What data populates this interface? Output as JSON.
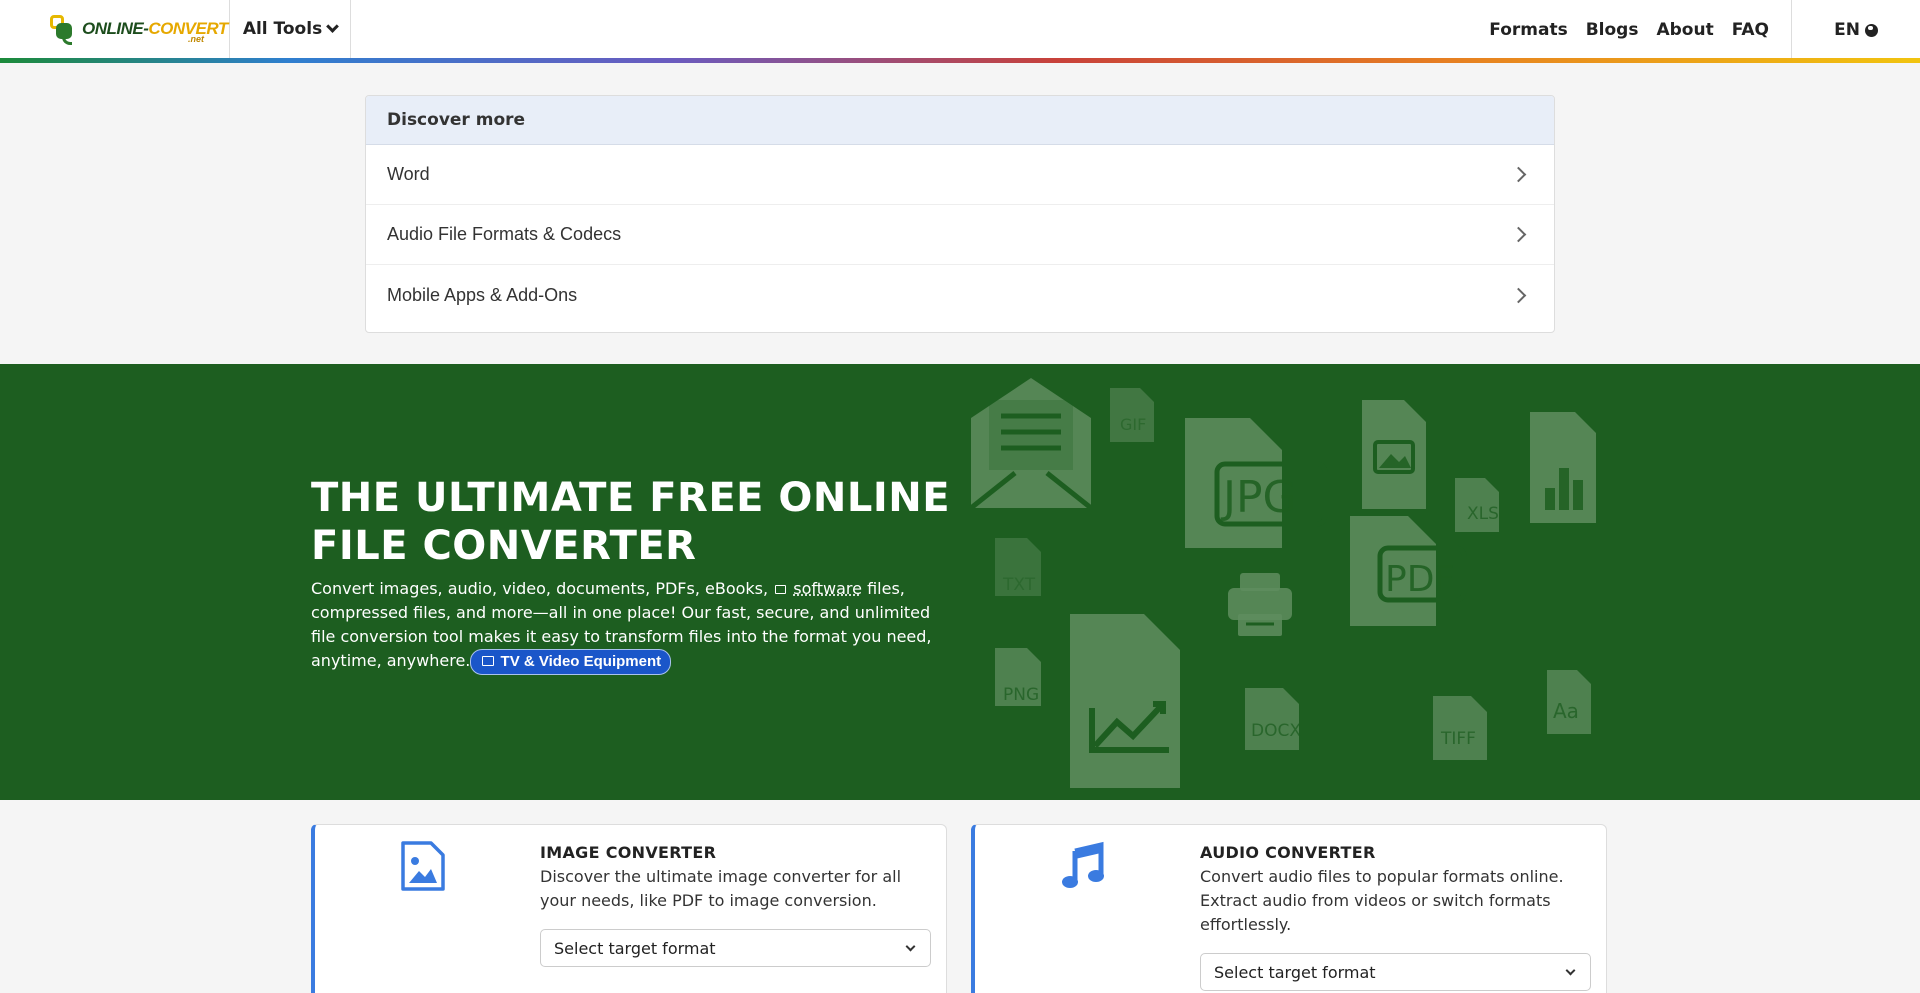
{
  "header": {
    "logo": {
      "part1": "ONLINE-",
      "part2": "CONVERT",
      "sub": ".net"
    },
    "all_tools_label": "All Tools",
    "nav": [
      "Formats",
      "Blogs",
      "About",
      "FAQ"
    ],
    "lang_label": "EN"
  },
  "discover": {
    "title": "Discover more",
    "items": [
      "Word",
      "Audio File Formats & Codecs",
      "Mobile Apps & Add-Ons"
    ]
  },
  "hero": {
    "title": "THE ULTIMATE FREE ONLINE FILE CONVERTER",
    "desc_part1": "Convert images, audio, video, documents, PDFs, eBooks,",
    "desc_link": "software",
    "desc_part2": " files, compressed files, and more—all in one place! Our fast, secure, and unlimited file conversion tool makes it easy to transform files into the format you need, anytime, anywhere.",
    "pill_label": "TV & Video Equipment",
    "art_labels": {
      "gif": "GIF",
      "jpg": "JPG",
      "xls": "XLS",
      "txt": "TXT",
      "pdf": "PDF",
      "png": "PNG",
      "docx": "DOCX",
      "tiff": "TIFF",
      "font": "Aa"
    }
  },
  "converters": [
    {
      "title": "IMAGE CONVERTER",
      "desc": "Discover the ultimate image converter for all your needs, like PDF to image conversion.",
      "select_label": "Select target format",
      "icon": "image-file-icon"
    },
    {
      "title": "AUDIO CONVERTER",
      "desc": "Convert audio files to popular formats online. Extract audio from videos or switch formats effortlessly.",
      "select_label": "Select target format",
      "icon": "music-note-icon"
    }
  ],
  "colors": {
    "hero_bg": "#1d5e20",
    "accent": "#3a7be0",
    "pill": "#1a56c9"
  }
}
